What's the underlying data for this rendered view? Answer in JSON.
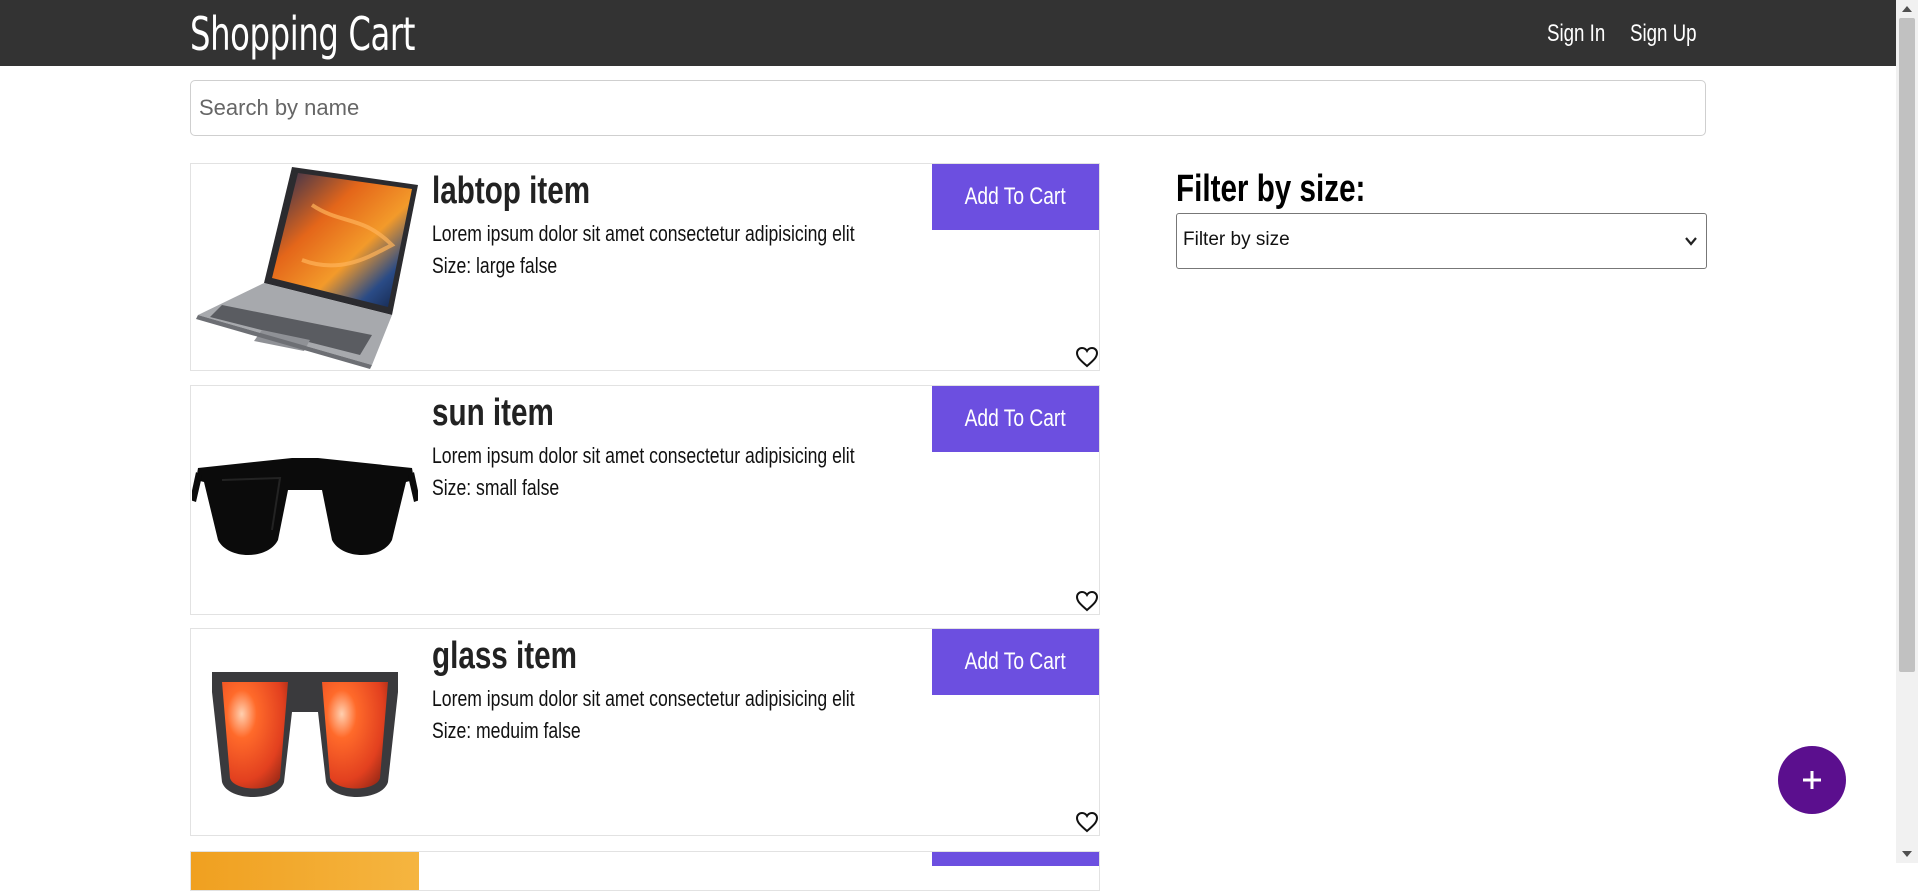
{
  "header": {
    "brand": "Shopping Cart",
    "sign_in": "Sign In",
    "sign_up": "Sign Up"
  },
  "search": {
    "placeholder": "Search by name",
    "value": ""
  },
  "products": [
    {
      "title": "labtop item",
      "description": "Lorem ipsum dolor sit amet consectetur adipisicing elit",
      "size": "Size: large false",
      "button": "Add To Cart"
    },
    {
      "title": "sun item",
      "description": "Lorem ipsum dolor sit amet consectetur adipisicing elit",
      "size": "Size: small false",
      "button": "Add To Cart"
    },
    {
      "title": "glass item",
      "description": "Lorem ipsum dolor sit amet consectetur adipisicing elit",
      "size": "Size: meduim false",
      "button": "Add To Cart"
    },
    {
      "title": "",
      "description": "",
      "size": "",
      "button": ""
    }
  ],
  "filter": {
    "title": "Filter by size:",
    "selected": "Filter by size"
  },
  "colors": {
    "header_bg": "#333333",
    "button_bg": "#6c4fe0",
    "fab_bg": "#5b0f8e"
  },
  "icons": {
    "wishlist": "heart-outline-icon",
    "add": "plus-icon",
    "dropdown": "chevron-down-icon"
  }
}
